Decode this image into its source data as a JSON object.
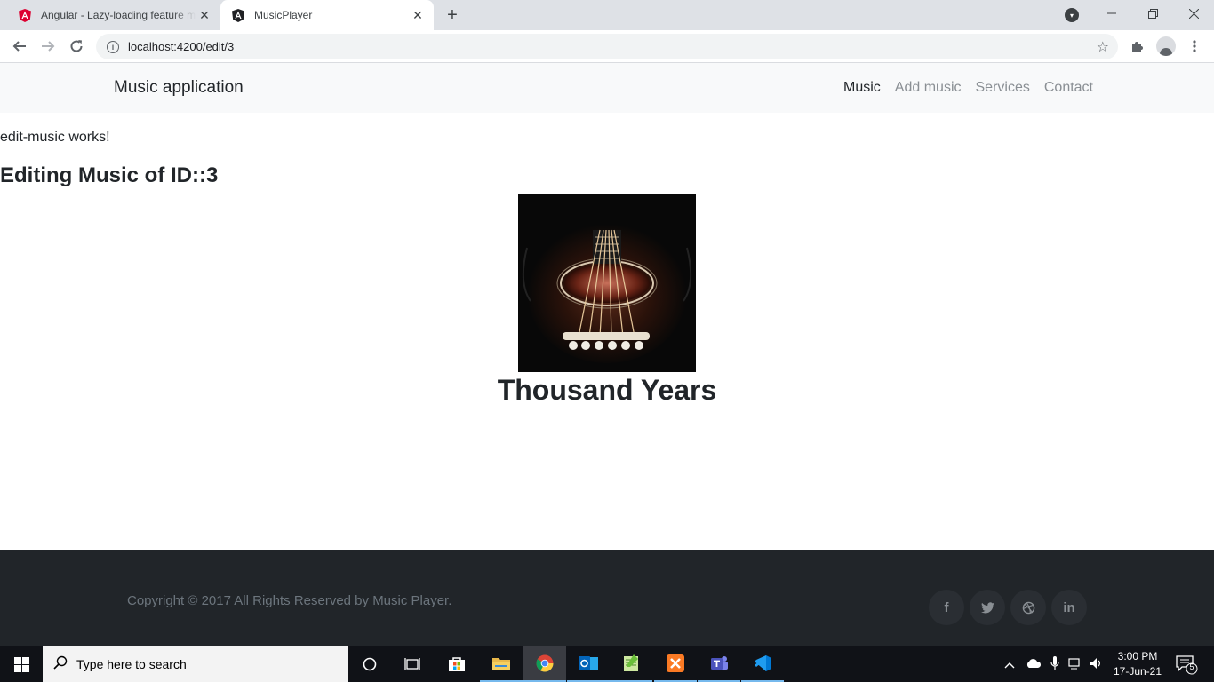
{
  "browser": {
    "tabs": [
      {
        "title": "Angular - Lazy-loading feature modules",
        "active": false,
        "icon": "angular-red-icon"
      },
      {
        "title": "MusicPlayer",
        "active": true,
        "icon": "angular-black-icon"
      }
    ],
    "new_tab_icon": "plus-icon",
    "url": "localhost:4200/edit/3"
  },
  "app": {
    "brand": "Music application",
    "nav": [
      {
        "label": "Music",
        "active": true
      },
      {
        "label": "Add music",
        "active": false
      },
      {
        "label": "Services",
        "active": false
      },
      {
        "label": "Contact",
        "active": false
      }
    ],
    "works_text": "edit-music works!",
    "editing_heading": "Editing Music of ID::3",
    "song_title": "Thousand Years",
    "cover_alt_icon": "guitar-image"
  },
  "footer": {
    "copyright": "Copyright © 2017 All Rights Reserved by Music Player.",
    "social": [
      "f",
      "t",
      "dribbble",
      "in"
    ]
  },
  "taskbar": {
    "search_placeholder": "Type here to search",
    "time": "3:00 PM",
    "date": "17-Jun-21",
    "notification_count": "5"
  },
  "colors": {
    "navbar_bg": "#f8f9fa",
    "footer_bg": "#212529",
    "taskbar_bg": "#101217"
  }
}
